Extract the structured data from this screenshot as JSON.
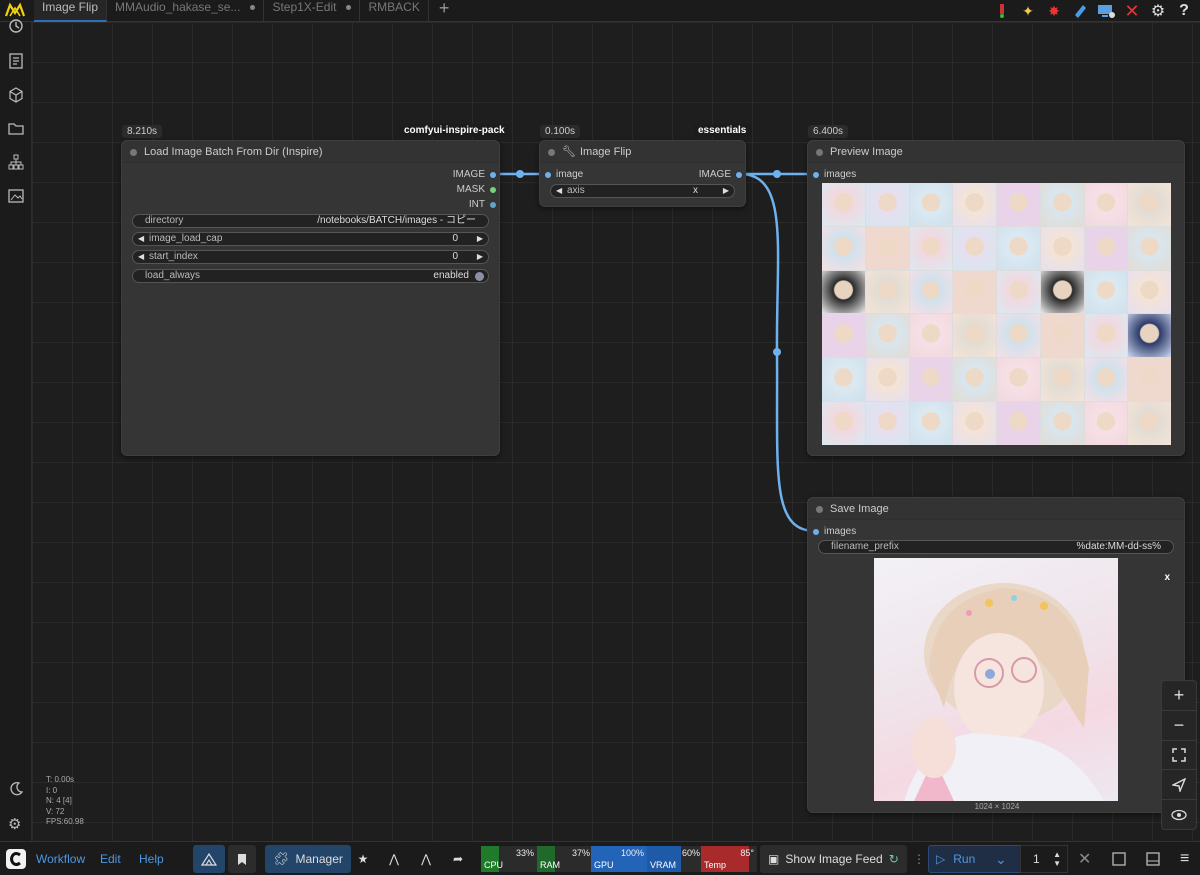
{
  "tabs": [
    {
      "label": "Image Flip",
      "active": true,
      "modified": false
    },
    {
      "label": "MMAudio_hakase_se...",
      "active": false,
      "modified": true
    },
    {
      "label": "Step1X-Edit",
      "active": false,
      "modified": true
    },
    {
      "label": "RMBACK",
      "active": false,
      "modified": false
    }
  ],
  "stats": {
    "t": "T: 0.00s",
    "i": "I: 0",
    "n": "N: 4 [4]",
    "v": "V: 72",
    "fps": "FPS:60.98"
  },
  "nodes": {
    "load": {
      "timing": "8.210s",
      "badge": "comfyui-inspire-pack",
      "title": "Load Image Batch From Dir (Inspire)",
      "outputs": [
        "IMAGE",
        "MASK",
        "INT"
      ],
      "widgets": {
        "directory": {
          "label": "directory",
          "value": "/notebooks/BATCH/images - コピー"
        },
        "image_load_cap": {
          "label": "image_load_cap",
          "value": "0"
        },
        "start_index": {
          "label": "start_index",
          "value": "0"
        },
        "load_always": {
          "label": "load_always",
          "value": "enabled"
        }
      }
    },
    "flip": {
      "timing": "0.100s",
      "badge": "essentials",
      "title": "Image Flip",
      "input": "image",
      "output": "IMAGE",
      "axis": {
        "label": "axis",
        "value": "x"
      }
    },
    "preview": {
      "timing": "6.400s",
      "title": "Preview Image",
      "input": "images"
    },
    "save": {
      "title": "Save Image",
      "input": "images",
      "filename_prefix": {
        "label": "filename_prefix",
        "value": "%date:MM-dd-ss%"
      },
      "close": "x",
      "resolution": "1024 × 1024"
    }
  },
  "bottombar": {
    "menus": [
      "Workflow",
      "Edit",
      "Help"
    ],
    "manager": "Manager",
    "meters": [
      {
        "label": "CPU",
        "value": "33%",
        "percent": 33,
        "color": "#1f7a2a"
      },
      {
        "label": "RAM",
        "value": "37%",
        "percent": 37,
        "color": "#1f6a2a"
      },
      {
        "label": "GPU",
        "value": "100%",
        "percent": 100,
        "color": "#2364b8"
      },
      {
        "label": "VRAM",
        "value": "60%",
        "percent": 60,
        "color": "#1f5aa8"
      },
      {
        "label": "Temp",
        "value": "85°",
        "percent": 85,
        "color": "#a82a2a"
      }
    ],
    "image_feed": "Show Image Feed",
    "run": "Run",
    "queue_count": "1"
  },
  "colors": {
    "accent": "#4f97e0",
    "link": "#6eb1ee"
  }
}
